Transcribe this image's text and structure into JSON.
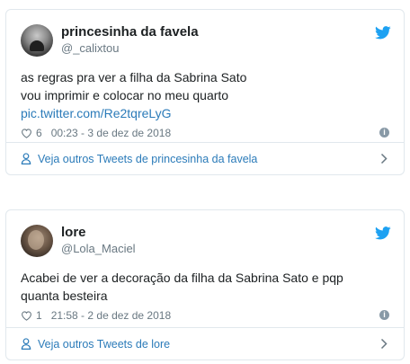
{
  "tweets": [
    {
      "display_name": "princesinha da favela",
      "handle": "@_calixtou",
      "text_lines": [
        "as regras pra ver a filha da Sabrina Sato",
        "vou imprimir e colocar no meu quarto"
      ],
      "link": "pic.twitter.com/Re2tqreLyG",
      "likes": "6",
      "timestamp": "00:23 - 3 de dez de 2018",
      "footer": "Veja outros Tweets de princesinha da favela"
    },
    {
      "display_name": "lore",
      "handle": "@Lola_Maciel",
      "text_lines": [
        "Acabei de ver a decoração da filha da Sabrina Sato e pqp",
        "quanta besteira"
      ],
      "likes": "1",
      "timestamp": "21:58 - 2 de dez de 2018",
      "footer": "Veja outros Tweets de lore"
    }
  ],
  "icons": {
    "brand": "twitter-bird-icon",
    "like": "heart-icon",
    "info": "info-icon",
    "profile": "person-icon",
    "navigate": "chevron-right-icon"
  },
  "colors": {
    "twitter_blue": "#1da1f2",
    "link": "#2b7bb9",
    "muted": "#697882",
    "border": "#e1e8ed"
  }
}
